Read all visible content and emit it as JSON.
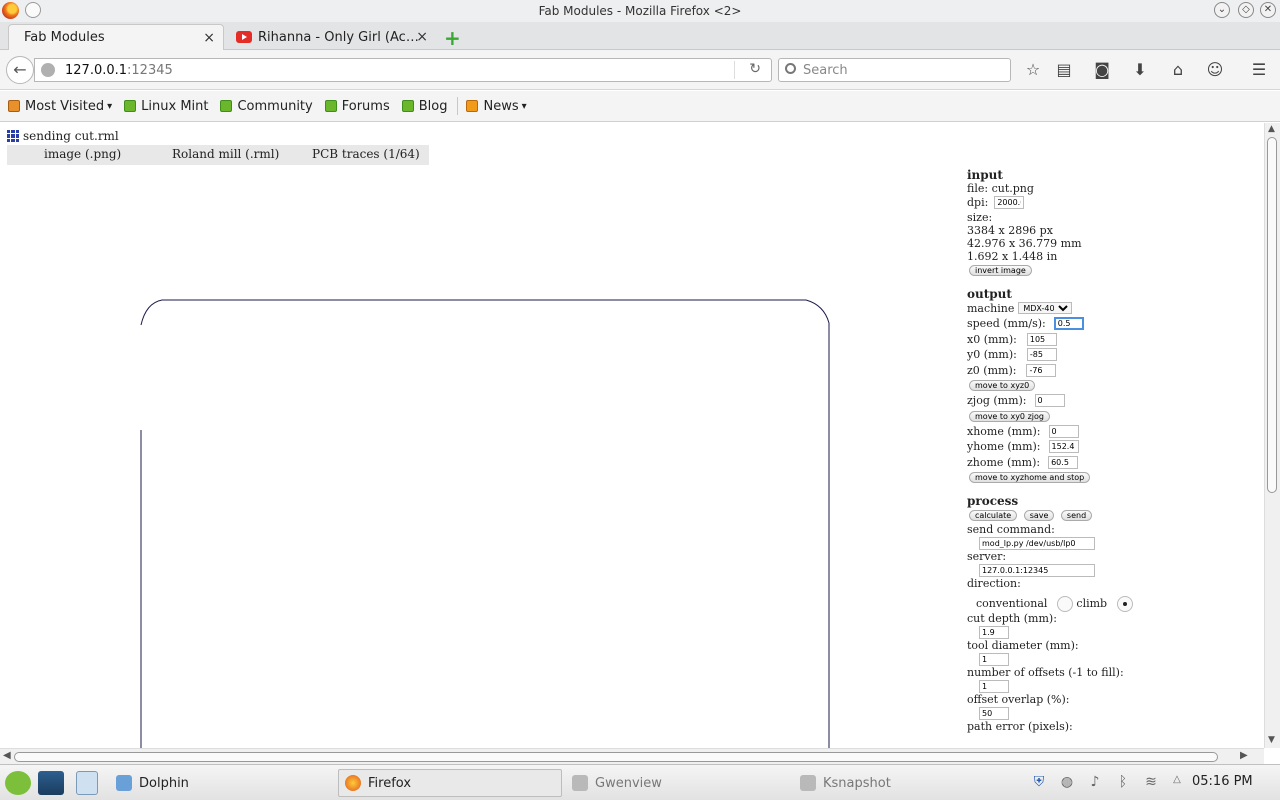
{
  "window": {
    "title": "Fab Modules - Mozilla Firefox <2>"
  },
  "tabs": [
    {
      "label": "Fab Modules",
      "close": "×"
    },
    {
      "label": "Rihanna - Only Girl (Ac…",
      "close": "×"
    }
  ],
  "new_tab": "+",
  "nav": {
    "url_host": "127.0.0.1",
    "url_port": ":12345",
    "search_placeholder": "Search"
  },
  "bookmarks": {
    "most_visited": "Most Visited",
    "items": [
      "Linux Mint",
      "Community",
      "Forums",
      "Blog"
    ],
    "news": "News"
  },
  "page": {
    "status": "sending cut.rml",
    "path": [
      "image (.png)",
      "Roland mill (.rml)",
      "PCB traces (1/64)"
    ],
    "input": {
      "heading": "input",
      "file": "file: cut.png",
      "dpi_label": "dpi:",
      "dpi_value": "2000.0",
      "size_label": "size:",
      "size_px": "3384 x 2896 px",
      "size_mm": "42.976 x 36.779 mm",
      "size_in": "1.692 x 1.448 in",
      "invert_button": "invert image"
    },
    "output": {
      "heading": "output",
      "machine_label": "machine",
      "machine_value": "MDX-40",
      "speed_label": "speed (mm/s):",
      "speed_value": "0.5",
      "x0_label": "x0 (mm):",
      "x0_value": "105",
      "y0_label": "y0 (mm):",
      "y0_value": "-85",
      "z0_label": "z0 (mm):",
      "z0_value": "-76",
      "move_xyz0": "move to xyz0",
      "zjog_label": "zjog (mm):",
      "zjog_value": "0",
      "move_xy0_zjog": "move to xy0 zjog",
      "xhome_label": "xhome (mm):",
      "xhome_value": "0",
      "yhome_label": "yhome (mm):",
      "yhome_value": "152.4",
      "zhome_label": "zhome (mm):",
      "zhome_value": "60.5",
      "move_home": "move to xyzhome and stop"
    },
    "process": {
      "heading": "process",
      "calculate": "calculate",
      "save": "save",
      "send": "send",
      "send_command_label": "send command:",
      "send_command_value": "mod_lp.py /dev/usb/lp0",
      "server_label": "server:",
      "server_value": "127.0.0.1:12345",
      "direction_label": "direction:",
      "conventional": "conventional",
      "climb": "climb",
      "cut_depth_label": "cut depth (mm):",
      "cut_depth_value": "1.9",
      "tool_diameter_label": "tool diameter (mm):",
      "tool_diameter_value": "1",
      "offsets_label": "number of offsets (-1 to fill):",
      "offsets_value": "1",
      "overlap_label": "offset overlap (%):",
      "overlap_value": "50",
      "path_error_label": "path error (pixels):"
    }
  },
  "taskbar": {
    "tasks": [
      "Dolphin",
      "Firefox",
      "Gwenview",
      "Ksnapshot"
    ],
    "clock": "05:16 PM"
  }
}
